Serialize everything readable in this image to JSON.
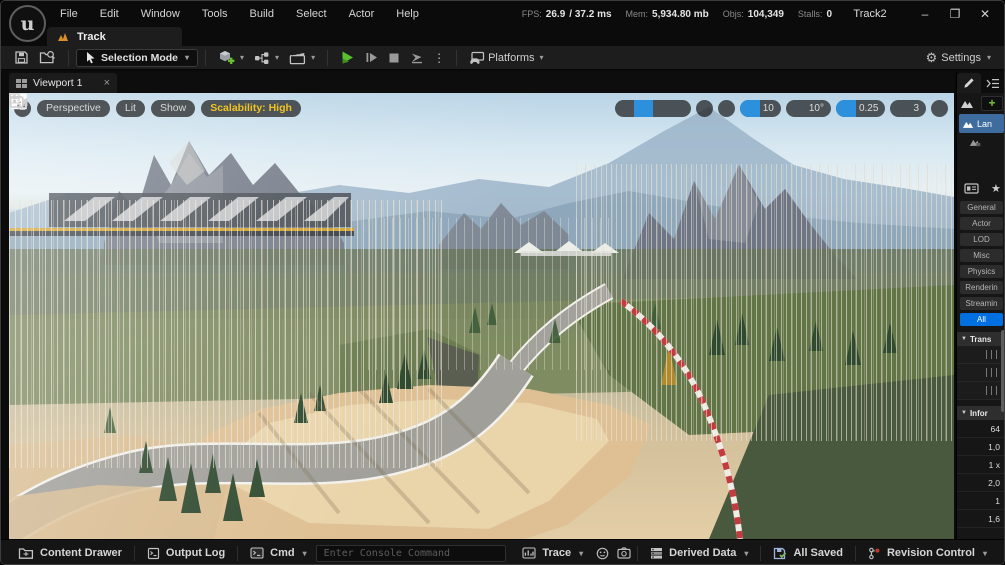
{
  "window": {
    "title": "Track2",
    "stats": {
      "fps_label": "FPS:",
      "fps": "26.9",
      "ms": "/ 37.2 ms",
      "mem_label": "Mem:",
      "mem": "5,934.80 mb",
      "objs_label": "Objs:",
      "objs": "104,349",
      "stalls_label": "Stalls:",
      "stalls": "0"
    },
    "controls": {
      "minimize": "–",
      "maximize": "❐",
      "close": "✕"
    }
  },
  "menu": {
    "items": [
      "File",
      "Edit",
      "Window",
      "Tools",
      "Build",
      "Select",
      "Actor",
      "Help"
    ]
  },
  "asset_tab": {
    "label": "Track"
  },
  "toolbar": {
    "selection_mode": "Selection Mode",
    "platforms": "Platforms",
    "settings": "Settings"
  },
  "viewport": {
    "tab": "Viewport 1",
    "perspective": "Perspective",
    "lit": "Lit",
    "show": "Show",
    "scalability": "Scalability: High",
    "grid_snap": "10",
    "rotation_snap": "10°",
    "scale_snap": "0.25",
    "camera_speed": "3"
  },
  "details": {
    "selected_item": "Lan",
    "categories": [
      "General",
      "Actor",
      "LOD",
      "Misc",
      "Physics",
      "Renderin",
      "Streamin",
      "All"
    ],
    "active_category": "All",
    "sections": {
      "transform": "Trans",
      "information": "Infor"
    },
    "info_values": [
      "64",
      "1,0",
      "1 x",
      "2,0",
      "1",
      "1,6"
    ]
  },
  "status_bar": {
    "content_drawer": "Content Drawer",
    "output_log": "Output Log",
    "cmd": "Cmd",
    "console_placeholder": "Enter Console Command",
    "trace": "Trace",
    "derived_data": "Derived Data",
    "save_status": "All Saved",
    "revision_control": "Revision Control"
  },
  "colors": {
    "accent_blue": "#0070e0",
    "tool_highlight_blue": "#2d90dd",
    "play_green": "#58c22e",
    "scalability_yellow": "#f0c420",
    "selection_row_blue": "#3f6c9e",
    "barrier_red": "#c23b3f",
    "track_icon_orange": "#d98e2b",
    "revision_dot_red": "#c0392b"
  }
}
